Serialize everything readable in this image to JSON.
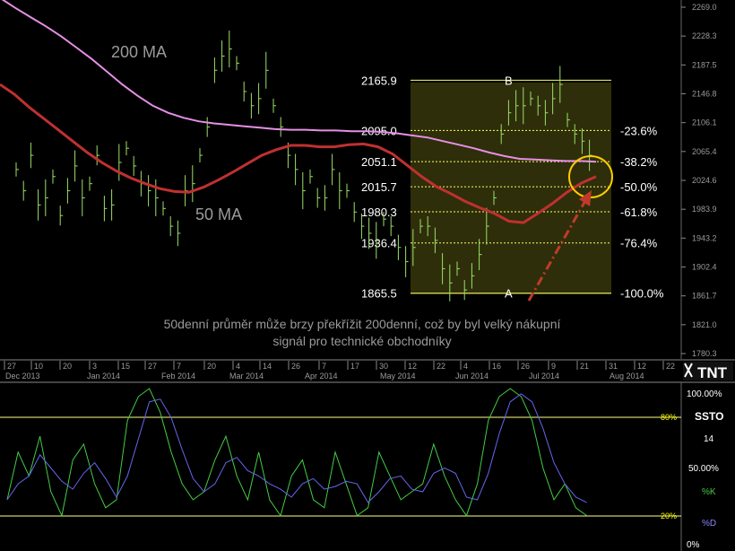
{
  "chart_data": [
    {
      "type": "bar",
      "subtype": "ohlc",
      "ylim": [
        1780.3,
        2269.0
      ],
      "yticks": [
        "2269.0",
        "2228.3",
        "2187.5",
        "2146.8",
        "2106.1",
        "2065.4",
        "2024.6",
        "1983.9",
        "1943.2",
        "1902.4",
        "1861.7",
        "1821.0",
        "1780.3"
      ],
      "xticks": [
        {
          "label": "27",
          "row": "day"
        },
        {
          "label": "10",
          "row": "day"
        },
        {
          "label": "20",
          "row": "day"
        },
        {
          "label": "3",
          "row": "day"
        },
        {
          "label": "15",
          "row": "day"
        },
        {
          "label": "27",
          "row": "day"
        },
        {
          "label": "7",
          "row": "day"
        },
        {
          "label": "20",
          "row": "day"
        },
        {
          "label": "4",
          "row": "day"
        },
        {
          "label": "14",
          "row": "day"
        },
        {
          "label": "26",
          "row": "day"
        },
        {
          "label": "7",
          "row": "day"
        },
        {
          "label": "17",
          "row": "day"
        },
        {
          "label": "30",
          "row": "day"
        },
        {
          "label": "12",
          "row": "day"
        },
        {
          "label": "22",
          "row": "day"
        },
        {
          "label": "4",
          "row": "day"
        },
        {
          "label": "16",
          "row": "day"
        },
        {
          "label": "26",
          "row": "day"
        },
        {
          "label": "9",
          "row": "day"
        },
        {
          "label": "21",
          "row": "day"
        },
        {
          "label": "31",
          "row": "day"
        },
        {
          "label": "12",
          "row": "day"
        },
        {
          "label": "22",
          "row": "day"
        }
      ],
      "months": [
        "Dec 2013",
        "Jan 2014",
        "Feb 2014",
        "Mar 2014",
        "Apr 2014",
        "May 2014",
        "Jun 2014",
        "Jul 2014",
        "Aug 2014"
      ],
      "series": [
        {
          "name": "200 MA",
          "color": "#e68fe6",
          "values": [
            2282,
            2268,
            2255,
            2242,
            2228,
            2212,
            2196,
            2178,
            2160,
            2144,
            2130,
            2120,
            2113,
            2108,
            2105,
            2103,
            2101,
            2099,
            2097,
            2096,
            2096,
            2095,
            2095,
            2094,
            2094,
            2093,
            2091,
            2088,
            2085,
            2080,
            2075,
            2070,
            2064,
            2059,
            2055,
            2054,
            2053,
            2052,
            2052,
            2051
          ]
        },
        {
          "name": "50 MA",
          "color": "#c03030",
          "values": [
            2160,
            2146,
            2128,
            2112,
            2096,
            2080,
            2064,
            2050,
            2038,
            2028,
            2020,
            2013,
            2009,
            2008,
            2015,
            2025,
            2036,
            2048,
            2060,
            2068,
            2074,
            2074,
            2072,
            2072,
            2075,
            2076,
            2072,
            2062,
            2046,
            2030,
            2016,
            2006,
            1995,
            1986,
            1978,
            1967,
            1965,
            1978,
            1992,
            2008,
            2021,
            2030
          ]
        }
      ],
      "fibonacci": [
        {
          "price": "2165.9",
          "pct": "",
          "marker": "B"
        },
        {
          "price": "2095.0",
          "pct": "-23.6%",
          "marker": ""
        },
        {
          "price": "2051.1",
          "pct": "-38.2%",
          "marker": ""
        },
        {
          "price": "2015.7",
          "pct": "-50.0%",
          "marker": ""
        },
        {
          "price": "1980.3",
          "pct": "-61.8%",
          "marker": ""
        },
        {
          "price": "1936.4",
          "pct": "-76.4%",
          "marker": ""
        },
        {
          "price": "1865.5",
          "pct": "-100.0%",
          "marker": "A"
        }
      ],
      "annotation": "50denní průměr může brzy překřížit 200denní, což by byl velký nákupní signál pro technické obchodníky"
    },
    {
      "type": "line",
      "name": "SSTO",
      "period": "14",
      "ylim": [
        0,
        100
      ],
      "levels": [
        {
          "value": 80,
          "label": "80%"
        },
        {
          "value": 20,
          "label": "20%"
        }
      ],
      "right_labels": {
        "top": "100.00%",
        "mid": "50.00%",
        "bottom": "0%"
      },
      "series": [
        {
          "name": "%K",
          "color": "#44cc44"
        },
        {
          "name": "%D",
          "color": "#6666ee"
        }
      ]
    }
  ],
  "ui": {
    "logo_text": "TNT"
  }
}
